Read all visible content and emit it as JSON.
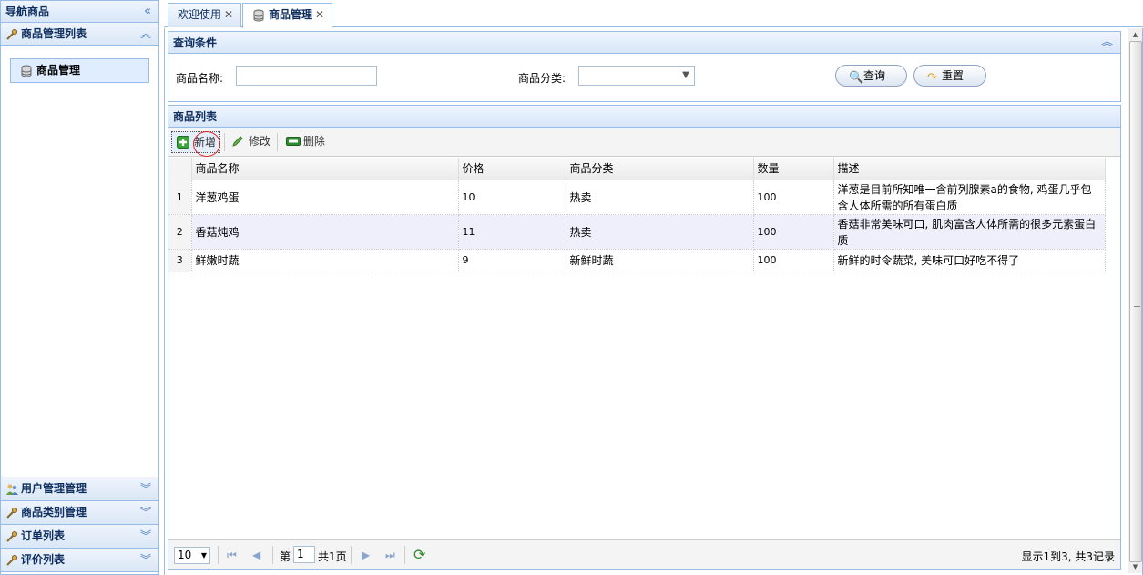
{
  "nav": {
    "title": "导航商品",
    "collapse_glyph": "«",
    "sections": [
      {
        "label": "商品管理列表",
        "icon": "wrench-icon",
        "expanded": true
      },
      {
        "label": "用户管理管理",
        "icon": "users-icon",
        "expanded": false
      },
      {
        "label": "商品类别管理",
        "icon": "wrench-icon",
        "expanded": false
      },
      {
        "label": "订单列表",
        "icon": "wrench-icon",
        "expanded": false
      },
      {
        "label": "评价列表",
        "icon": "wrench-icon",
        "expanded": false
      }
    ],
    "active_item": {
      "label": "商品管理",
      "icon": "database-icon"
    }
  },
  "tabs": [
    {
      "label": "欢迎使用",
      "active": false
    },
    {
      "label": "商品管理",
      "active": true,
      "icon": "database-icon"
    }
  ],
  "query": {
    "title": "查询条件",
    "name_label": "商品名称:",
    "name_value": "",
    "category_label": "商品分类:",
    "category_value": "",
    "search_button": "查询",
    "reset_button": "重置"
  },
  "grid": {
    "title": "商品列表",
    "toolbar": {
      "add": "新增",
      "edit": "修改",
      "delete": "删除"
    },
    "columns": [
      "商品名称",
      "价格",
      "商品分类",
      "数量",
      "描述"
    ],
    "rows": [
      {
        "num": "1",
        "name": "洋葱鸡蛋",
        "price": "10",
        "category": "热卖",
        "qty": "100",
        "desc": "洋葱是目前所知唯一含前列腺素a的食物, 鸡蛋几乎包含人体所需的所有蛋白质"
      },
      {
        "num": "2",
        "name": "香菇炖鸡",
        "price": "11",
        "category": "热卖",
        "qty": "100",
        "desc": "香菇非常美味可口, 肌肉富含人体所需的很多元素蛋白质"
      },
      {
        "num": "3",
        "name": "鲜嫩时蔬",
        "price": "9",
        "category": "新鲜时蔬",
        "qty": "100",
        "desc": "新鲜的时令蔬菜, 美味可口好吃不得了"
      }
    ],
    "pager": {
      "page_size": "10",
      "page_prefix": "第",
      "page_value": "1",
      "page_suffix": "共1页",
      "info": "显示1到3, 共3记录"
    }
  },
  "colors": {
    "border": "#99bbe8",
    "header_text": "#0e2d5f",
    "alt_row": "#eeeffb",
    "highlight_circle": "#dd2222"
  }
}
